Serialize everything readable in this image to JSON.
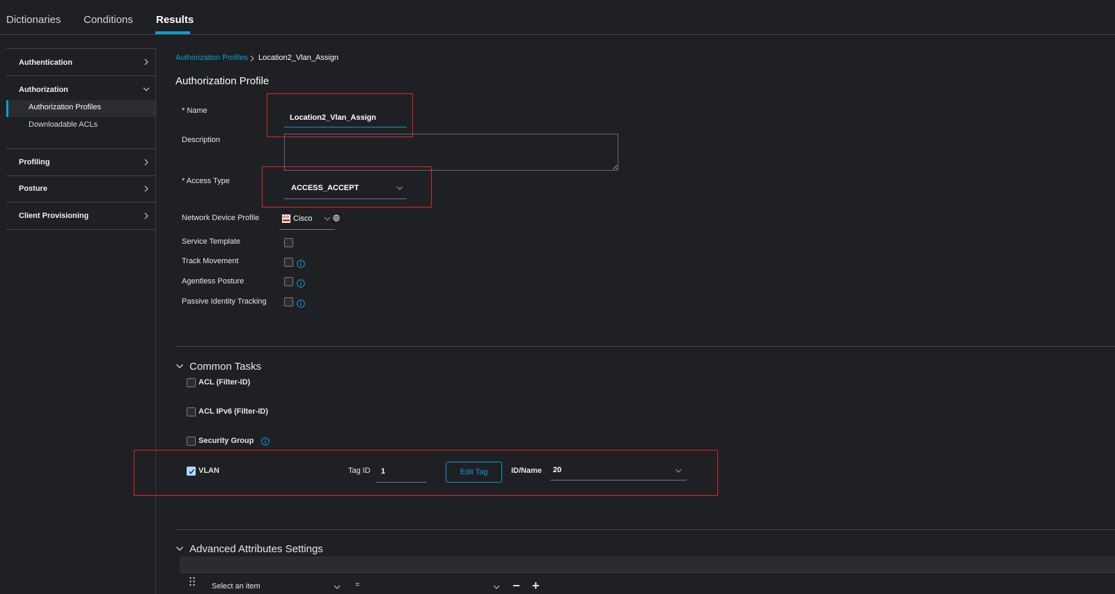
{
  "top_tabs": [
    {
      "label": "Dictionaries",
      "active": false
    },
    {
      "label": "Conditions",
      "active": false
    },
    {
      "label": "Results",
      "active": true
    }
  ],
  "sidebar": {
    "sections": [
      {
        "label": "Authentication",
        "expanded": false
      },
      {
        "label": "Authorization",
        "expanded": true,
        "items": [
          "Authorization Profiles",
          "Downloadable ACLs"
        ],
        "active_item": "Authorization Profiles"
      },
      {
        "label": "Profiling",
        "expanded": false
      },
      {
        "label": "Posture",
        "expanded": false
      },
      {
        "label": "Client Provisioning",
        "expanded": false
      }
    ]
  },
  "breadcrumb": {
    "parent": "Authorization Profiles",
    "separator": ">",
    "current": "Location2_Vlan_Assign"
  },
  "page_title": "Authorization Profile",
  "form": {
    "name_label": "* Name",
    "name_value": "Location2_Vlan_Assign",
    "description_label": "Description",
    "description_value": "",
    "access_type_label": "* Access Type",
    "access_type_value": "ACCESS_ACCEPT",
    "network_device_profile_label": "Network Device Profile",
    "network_device_profile_value": "Cisco",
    "service_template_label": "Service Template",
    "track_movement_label": "Track Movement",
    "agentless_posture_label": "Agentless Posture",
    "passive_identity_label": "Passive Identity Tracking"
  },
  "common_tasks": {
    "title": "Common Tasks",
    "acl_label": "ACL  (Filter-ID)",
    "acl_ipv6_label": "ACL IPv6 (Filter-ID)",
    "security_group_label": "Security Group",
    "vlan_label": "VLAN",
    "vlan_checked": true,
    "tag_id_label": "Tag ID",
    "tag_id_value": "1",
    "edit_tag_label": "Edit Tag",
    "id_name_label": "ID/Name",
    "id_name_value": "20"
  },
  "advanced": {
    "title": "Advanced Attributes Settings",
    "select_placeholder": "Select an item",
    "operator": "=",
    "remove_label": "−",
    "add_label": "+"
  },
  "colors": {
    "accent": "#0d9ed5",
    "highlight_box": "#e0262a",
    "background": "#1f2023"
  }
}
